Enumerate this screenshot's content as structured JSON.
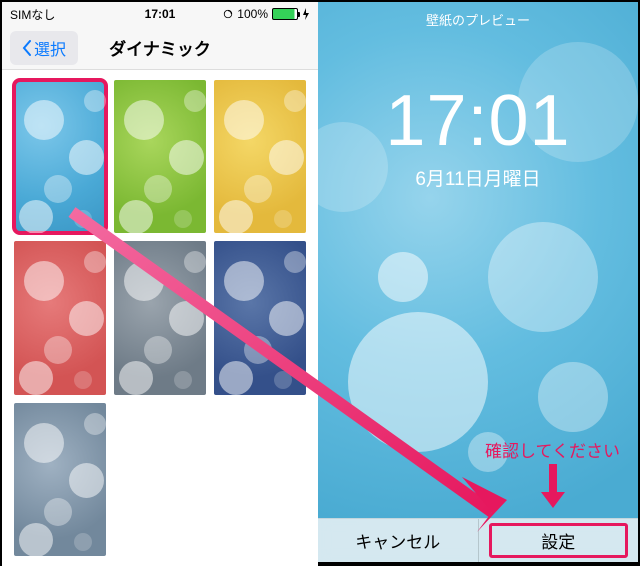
{
  "statusbar": {
    "carrier": "SIMなし",
    "time": "17:01",
    "battery": "100%"
  },
  "nav": {
    "back": "選択",
    "title": "ダイナミック"
  },
  "wallpapers": [
    {
      "name": "blue",
      "class": "c-blue",
      "selected": true
    },
    {
      "name": "green",
      "class": "c-green",
      "selected": false
    },
    {
      "name": "yellow",
      "class": "c-yellow",
      "selected": false
    },
    {
      "name": "red",
      "class": "c-red",
      "selected": false
    },
    {
      "name": "gray",
      "class": "c-gray",
      "selected": false
    },
    {
      "name": "navy",
      "class": "c-navy",
      "selected": false
    },
    {
      "name": "slate",
      "class": "c-slate",
      "selected": false
    }
  ],
  "preview": {
    "header": "壁紙のプレビュー",
    "time": "17:01",
    "date": "6月11日月曜日",
    "cancel": "キャンセル",
    "set": "設定"
  },
  "annotation": {
    "text": "確認してください",
    "color": "#e6185e"
  }
}
